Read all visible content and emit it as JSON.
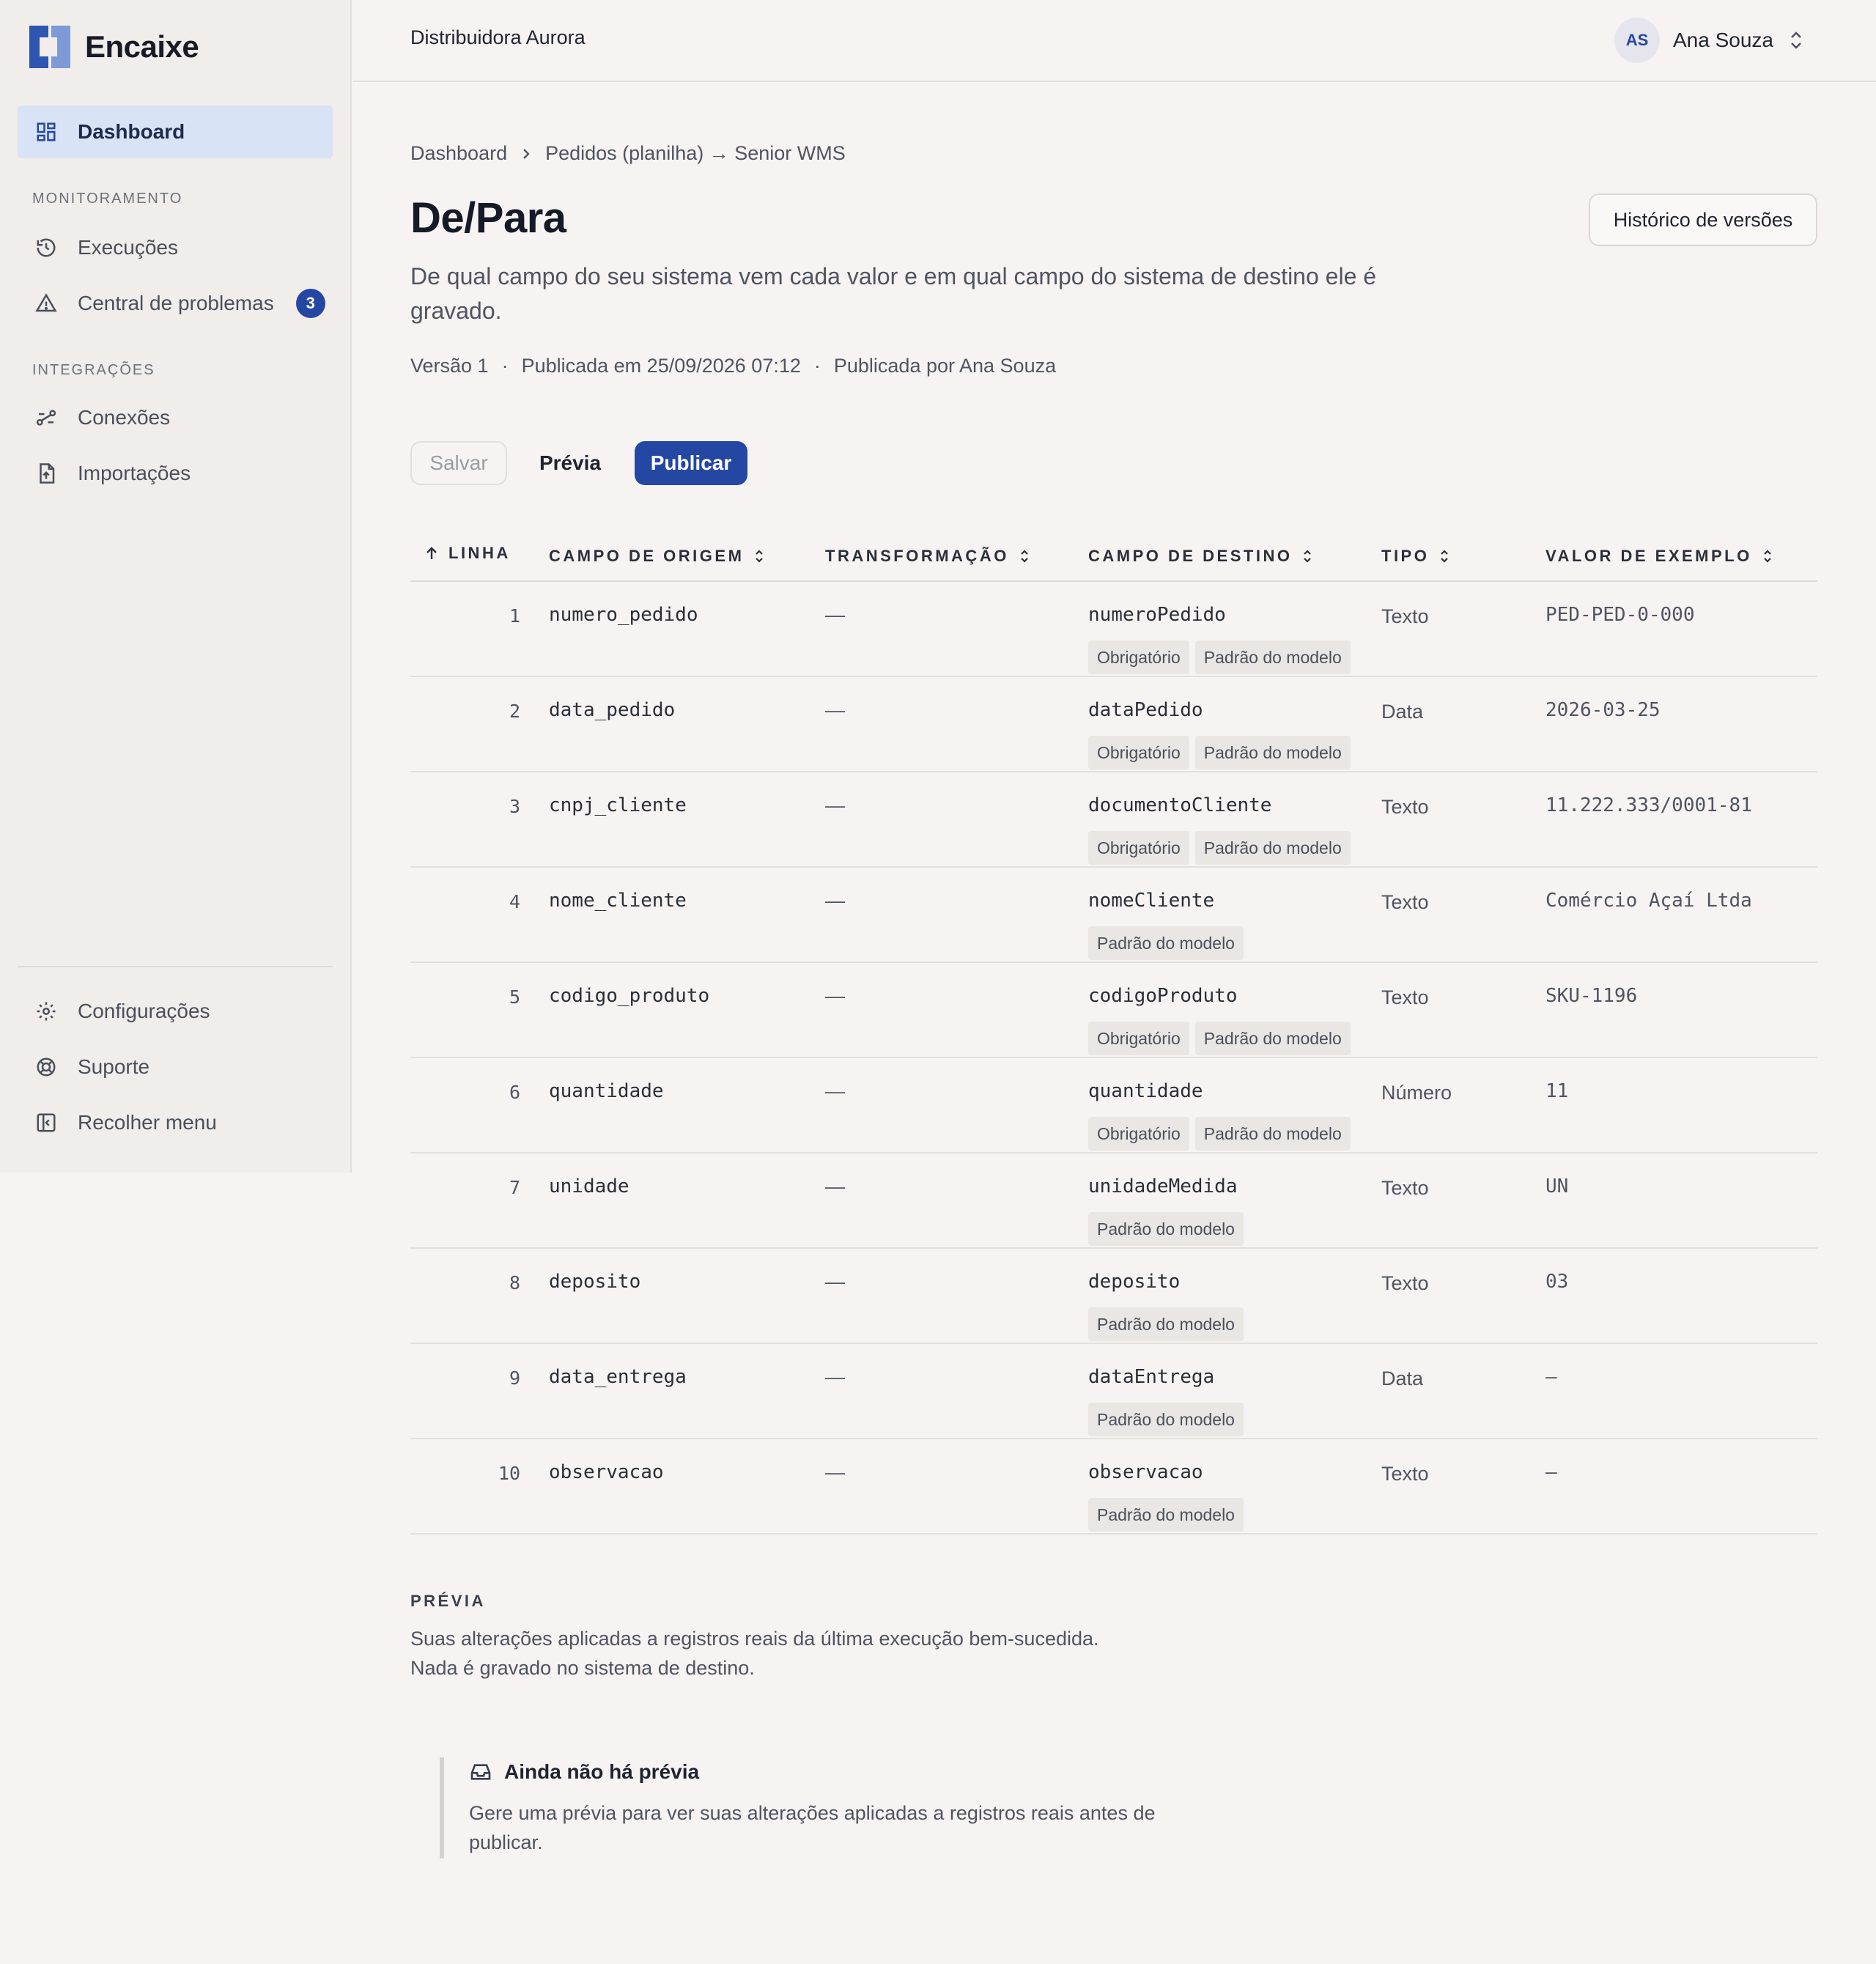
{
  "brand": {
    "name": "Encaixe"
  },
  "sidebar": {
    "dashboard": "Dashboard",
    "section_monitor": "MONITORAMENTO",
    "runs": "Execuções",
    "problems": "Central de problemas",
    "problems_count": "3",
    "section_integrations": "INTEGRAÇÕES",
    "connections": "Conexões",
    "imports": "Importações",
    "settings": "Configurações",
    "support": "Suporte",
    "collapse": "Recolher menu"
  },
  "header": {
    "org": "Distribuidora Aurora",
    "user_initials": "AS",
    "user_name": "Ana Souza"
  },
  "breadcrumb": {
    "root": "Dashboard",
    "current": "Pedidos (planilha) → Senior WMS"
  },
  "page": {
    "title": "De/Para",
    "history_button": "Histórico de versões",
    "subtitle": "De qual campo do seu sistema vem cada valor e em qual campo do sistema de destino ele é gravado.",
    "version": "Versão 1",
    "published_at": "Publicada em 25/09/2026 07:12",
    "published_by": "Publicada por Ana Souza",
    "dot": "·"
  },
  "actions": {
    "save": "Salvar",
    "preview": "Prévia",
    "publish": "Publicar"
  },
  "table": {
    "headers": [
      "LINHA",
      "CAMPO DE ORIGEM",
      "TRANSFORMAÇÃO",
      "CAMPO DE DESTINO",
      "TIPO",
      "VALOR DE EXEMPLO"
    ],
    "rows": [
      {
        "n": "1",
        "src": "numero_pedido",
        "trans": "—",
        "dest": "numeroPedido",
        "type": "Texto",
        "example": "PED-PED-0-000",
        "tags": [
          "Obrigatório",
          "Padrão do modelo"
        ]
      },
      {
        "n": "2",
        "src": "data_pedido",
        "trans": "—",
        "dest": "dataPedido",
        "type": "Data",
        "example": "2026-03-25",
        "tags": [
          "Obrigatório",
          "Padrão do modelo"
        ]
      },
      {
        "n": "3",
        "src": "cnpj_cliente",
        "trans": "—",
        "dest": "documentoCliente",
        "type": "Texto",
        "example": "11.222.333/0001-81",
        "tags": [
          "Obrigatório",
          "Padrão do modelo"
        ]
      },
      {
        "n": "4",
        "src": "nome_cliente",
        "trans": "—",
        "dest": "nomeCliente",
        "type": "Texto",
        "example": "Comércio Açaí Ltda",
        "tags": [
          "Padrão do modelo"
        ]
      },
      {
        "n": "5",
        "src": "codigo_produto",
        "trans": "—",
        "dest": "codigoProduto",
        "type": "Texto",
        "example": "SKU-1196",
        "tags": [
          "Obrigatório",
          "Padrão do modelo"
        ]
      },
      {
        "n": "6",
        "src": "quantidade",
        "trans": "—",
        "dest": "quantidade",
        "type": "Número",
        "example": "11",
        "tags": [
          "Obrigatório",
          "Padrão do modelo"
        ]
      },
      {
        "n": "7",
        "src": "unidade",
        "trans": "—",
        "dest": "unidadeMedida",
        "type": "Texto",
        "example": "UN",
        "tags": [
          "Padrão do modelo"
        ]
      },
      {
        "n": "8",
        "src": "deposito",
        "trans": "—",
        "dest": "deposito",
        "type": "Texto",
        "example": "03",
        "tags": [
          "Padrão do modelo"
        ]
      },
      {
        "n": "9",
        "src": "data_entrega",
        "trans": "—",
        "dest": "dataEntrega",
        "type": "Data",
        "example": "—",
        "tags": [
          "Padrão do modelo"
        ]
      },
      {
        "n": "10",
        "src": "observacao",
        "trans": "—",
        "dest": "observacao",
        "type": "Texto",
        "example": "—",
        "tags": [
          "Padrão do modelo"
        ]
      }
    ]
  },
  "preview": {
    "heading": "PRÉVIA",
    "line1": "Suas alterações aplicadas a registros reais da última execução bem-sucedida.",
    "line2": "Nada é gravado no sistema de destino.",
    "empty_title": "Ainda não há prévia",
    "empty_text": "Gere uma prévia para ver suas alterações aplicadas a registros reais antes de publicar."
  },
  "colors": {
    "accent": "#2447a3",
    "active_nav": "#d9e3f6",
    "background": "#f7f3f2"
  }
}
